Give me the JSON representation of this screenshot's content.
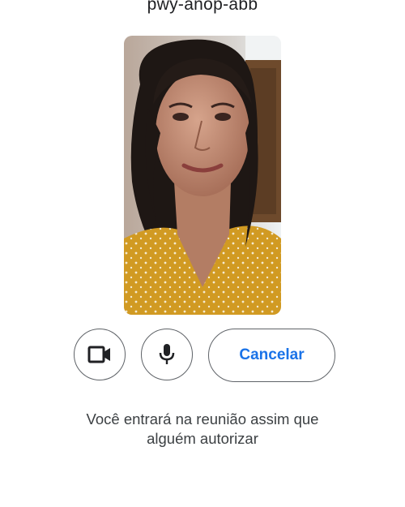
{
  "meeting": {
    "code": "pwy-anop-abb"
  },
  "preview": {
    "description_icon": "self-video-preview"
  },
  "controls": {
    "camera_icon": "video-camera-icon",
    "mic_icon": "microphone-icon",
    "cancel_label": "Cancelar"
  },
  "message": {
    "line1": "Você entrará na reunião assim que",
    "line2": "alguém autorizar"
  },
  "colors": {
    "accent": "#1a73e8",
    "text": "#3c4043",
    "border": "#5f6368"
  }
}
